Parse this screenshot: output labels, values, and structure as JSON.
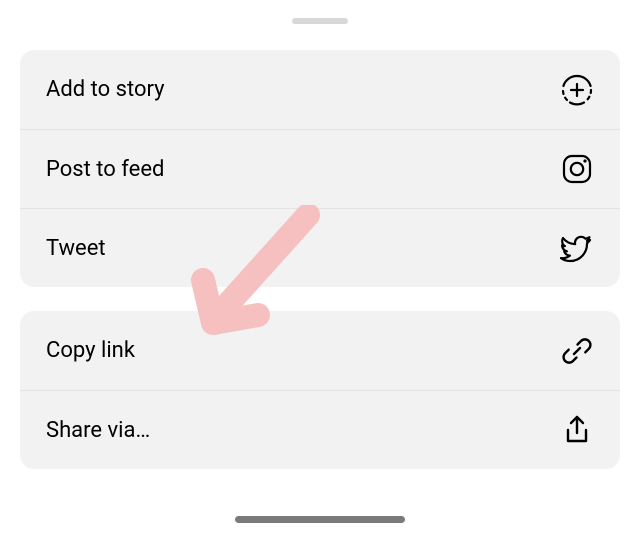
{
  "menu": {
    "group1": {
      "items": [
        {
          "label": "Add to story",
          "icon": "add-story-icon"
        },
        {
          "label": "Post to feed",
          "icon": "instagram-icon"
        },
        {
          "label": "Tweet",
          "icon": "twitter-icon"
        }
      ]
    },
    "group2": {
      "items": [
        {
          "label": "Copy link",
          "icon": "link-icon"
        },
        {
          "label": "Share via…",
          "icon": "share-icon"
        }
      ]
    }
  }
}
